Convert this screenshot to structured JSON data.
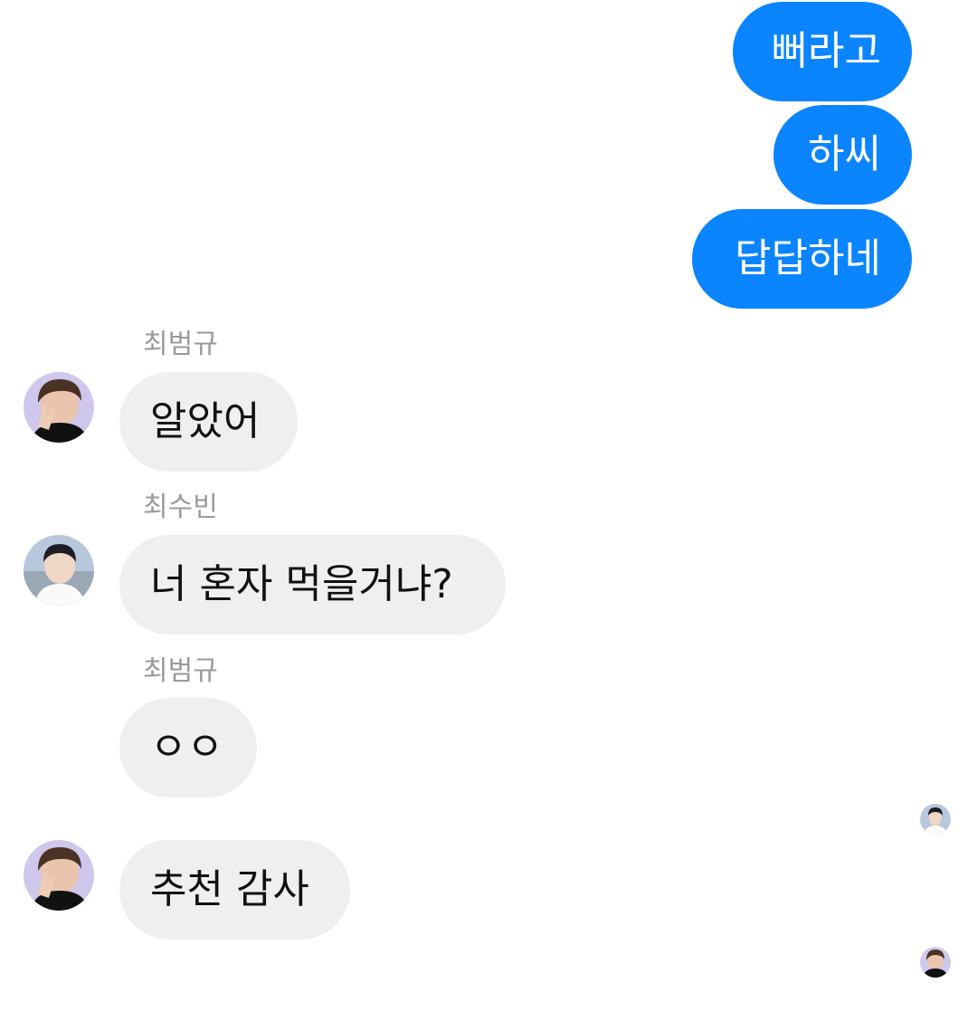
{
  "messages": [
    {
      "direction": "outgoing",
      "text": "뻐라고"
    },
    {
      "direction": "outgoing",
      "text": "하씨"
    },
    {
      "direction": "outgoing",
      "text": "답답하네"
    },
    {
      "direction": "incoming",
      "sender": "최범규",
      "text": "알았어",
      "avatar": "beomgyu-avatar"
    },
    {
      "direction": "incoming",
      "sender": "최수빈",
      "text": "너 혼자 먹을거냐?",
      "avatar": "soobin-avatar"
    },
    {
      "direction": "incoming",
      "sender": "최범규",
      "text": "ㅇㅇ",
      "avatar": ""
    },
    {
      "direction": "incoming",
      "sender": "",
      "text": "추천 감사",
      "avatar": "beomgyu-avatar"
    }
  ],
  "read_receipts": [
    "soobin-avatar",
    "beomgyu-avatar"
  ],
  "colors": {
    "outgoing_bubble": "#0a84ff",
    "incoming_bubble": "#efefef",
    "sender_name": "#9a9a9a",
    "avatar_bg": "#cfc8ec"
  }
}
